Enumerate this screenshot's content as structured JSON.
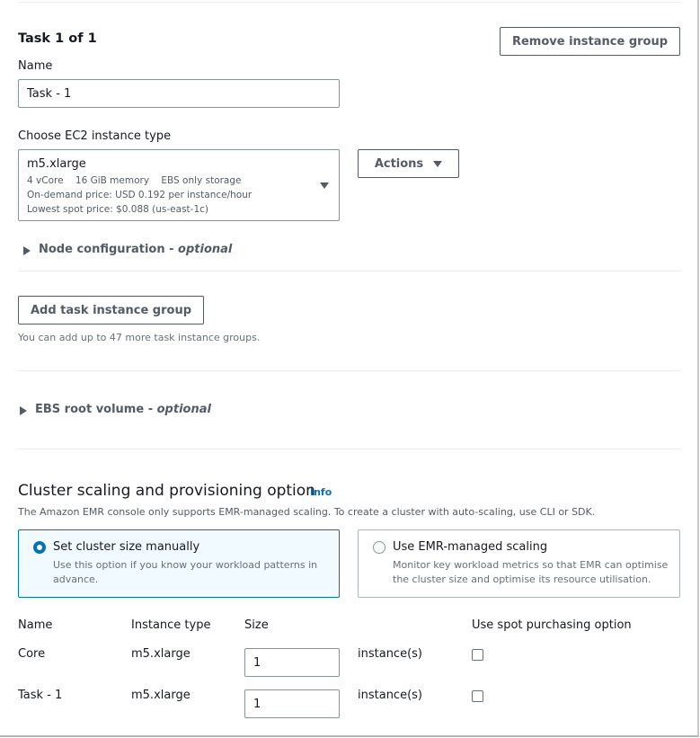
{
  "task_group": {
    "heading": "Task 1 of 1",
    "remove_button": "Remove instance group",
    "name_label": "Name",
    "name_value": "Task - 1",
    "instance_type_label": "Choose EC2 instance type",
    "instance_select": {
      "value": "m5.xlarge",
      "specs": "4 vCore    16 GiB memory    EBS only storage",
      "on_demand_price": "On-demand price: USD 0.192 per instance/hour",
      "spot_price": "Lowest spot price: $0.088 (us-east-1c)"
    },
    "actions_button": "Actions",
    "node_config": {
      "label": "Node configuration - ",
      "optional": "optional"
    }
  },
  "add_task": {
    "button": "Add task instance group",
    "hint": "You can add up to 47 more task instance groups."
  },
  "ebs_root": {
    "label": "EBS root volume - ",
    "optional": "optional"
  },
  "scaling": {
    "title": "Cluster scaling and provisioning option",
    "info": "Info",
    "description": "The Amazon EMR console only supports EMR-managed scaling. To create a cluster with auto-scaling, use CLI or SDK.",
    "options": [
      {
        "title": "Set cluster size manually",
        "description": "Use this option if you know your workload patterns in advance.",
        "selected": true
      },
      {
        "title": "Use EMR-managed scaling",
        "description": "Monitor key workload metrics so that EMR can optimise the cluster size and optimise its resource utilisation.",
        "selected": false
      }
    ]
  },
  "size_table": {
    "headers": [
      "Name",
      "Instance type",
      "Size",
      "Use spot purchasing option"
    ],
    "rows": [
      {
        "name": "Core",
        "instance_type": "m5.xlarge",
        "size": "1",
        "unit": "instance(s)",
        "spot": false
      },
      {
        "name": "Task - 1",
        "instance_type": "m5.xlarge",
        "size": "1",
        "unit": "instance(s)",
        "spot": false
      }
    ]
  },
  "colors": {
    "accent": "#0073bb",
    "text": "#16191f",
    "secondary_text": "#545b64",
    "border": "#879596"
  }
}
